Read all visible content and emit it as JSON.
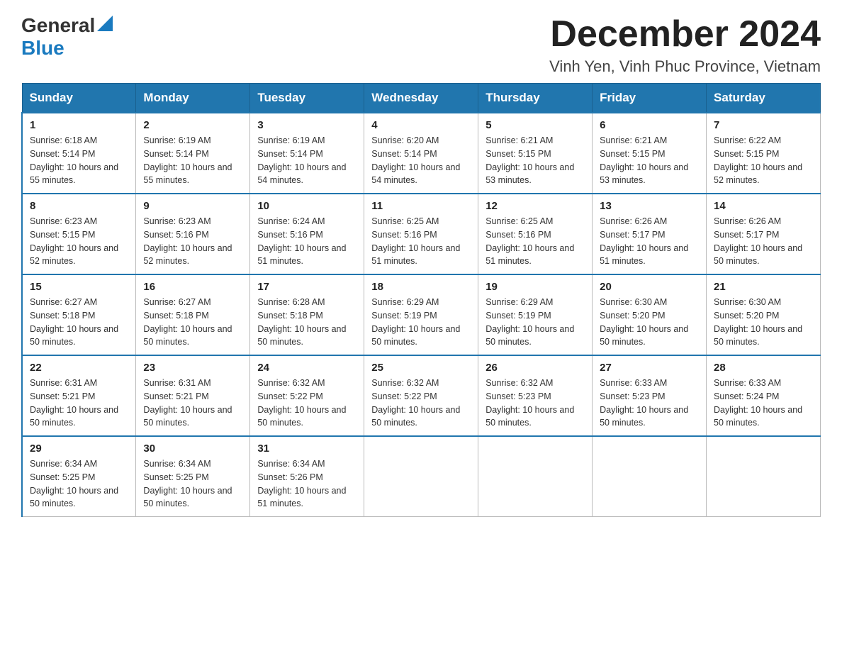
{
  "header": {
    "logo": {
      "general": "General",
      "blue": "Blue"
    },
    "month_title": "December 2024",
    "location": "Vinh Yen, Vinh Phuc Province, Vietnam"
  },
  "days_of_week": [
    "Sunday",
    "Monday",
    "Tuesday",
    "Wednesday",
    "Thursday",
    "Friday",
    "Saturday"
  ],
  "weeks": [
    [
      {
        "day": "1",
        "sunrise": "6:18 AM",
        "sunset": "5:14 PM",
        "daylight": "10 hours and 55 minutes."
      },
      {
        "day": "2",
        "sunrise": "6:19 AM",
        "sunset": "5:14 PM",
        "daylight": "10 hours and 55 minutes."
      },
      {
        "day": "3",
        "sunrise": "6:19 AM",
        "sunset": "5:14 PM",
        "daylight": "10 hours and 54 minutes."
      },
      {
        "day": "4",
        "sunrise": "6:20 AM",
        "sunset": "5:14 PM",
        "daylight": "10 hours and 54 minutes."
      },
      {
        "day": "5",
        "sunrise": "6:21 AM",
        "sunset": "5:15 PM",
        "daylight": "10 hours and 53 minutes."
      },
      {
        "day": "6",
        "sunrise": "6:21 AM",
        "sunset": "5:15 PM",
        "daylight": "10 hours and 53 minutes."
      },
      {
        "day": "7",
        "sunrise": "6:22 AM",
        "sunset": "5:15 PM",
        "daylight": "10 hours and 52 minutes."
      }
    ],
    [
      {
        "day": "8",
        "sunrise": "6:23 AM",
        "sunset": "5:15 PM",
        "daylight": "10 hours and 52 minutes."
      },
      {
        "day": "9",
        "sunrise": "6:23 AM",
        "sunset": "5:16 PM",
        "daylight": "10 hours and 52 minutes."
      },
      {
        "day": "10",
        "sunrise": "6:24 AM",
        "sunset": "5:16 PM",
        "daylight": "10 hours and 51 minutes."
      },
      {
        "day": "11",
        "sunrise": "6:25 AM",
        "sunset": "5:16 PM",
        "daylight": "10 hours and 51 minutes."
      },
      {
        "day": "12",
        "sunrise": "6:25 AM",
        "sunset": "5:16 PM",
        "daylight": "10 hours and 51 minutes."
      },
      {
        "day": "13",
        "sunrise": "6:26 AM",
        "sunset": "5:17 PM",
        "daylight": "10 hours and 51 minutes."
      },
      {
        "day": "14",
        "sunrise": "6:26 AM",
        "sunset": "5:17 PM",
        "daylight": "10 hours and 50 minutes."
      }
    ],
    [
      {
        "day": "15",
        "sunrise": "6:27 AM",
        "sunset": "5:18 PM",
        "daylight": "10 hours and 50 minutes."
      },
      {
        "day": "16",
        "sunrise": "6:27 AM",
        "sunset": "5:18 PM",
        "daylight": "10 hours and 50 minutes."
      },
      {
        "day": "17",
        "sunrise": "6:28 AM",
        "sunset": "5:18 PM",
        "daylight": "10 hours and 50 minutes."
      },
      {
        "day": "18",
        "sunrise": "6:29 AM",
        "sunset": "5:19 PM",
        "daylight": "10 hours and 50 minutes."
      },
      {
        "day": "19",
        "sunrise": "6:29 AM",
        "sunset": "5:19 PM",
        "daylight": "10 hours and 50 minutes."
      },
      {
        "day": "20",
        "sunrise": "6:30 AM",
        "sunset": "5:20 PM",
        "daylight": "10 hours and 50 minutes."
      },
      {
        "day": "21",
        "sunrise": "6:30 AM",
        "sunset": "5:20 PM",
        "daylight": "10 hours and 50 minutes."
      }
    ],
    [
      {
        "day": "22",
        "sunrise": "6:31 AM",
        "sunset": "5:21 PM",
        "daylight": "10 hours and 50 minutes."
      },
      {
        "day": "23",
        "sunrise": "6:31 AM",
        "sunset": "5:21 PM",
        "daylight": "10 hours and 50 minutes."
      },
      {
        "day": "24",
        "sunrise": "6:32 AM",
        "sunset": "5:22 PM",
        "daylight": "10 hours and 50 minutes."
      },
      {
        "day": "25",
        "sunrise": "6:32 AM",
        "sunset": "5:22 PM",
        "daylight": "10 hours and 50 minutes."
      },
      {
        "day": "26",
        "sunrise": "6:32 AM",
        "sunset": "5:23 PM",
        "daylight": "10 hours and 50 minutes."
      },
      {
        "day": "27",
        "sunrise": "6:33 AM",
        "sunset": "5:23 PM",
        "daylight": "10 hours and 50 minutes."
      },
      {
        "day": "28",
        "sunrise": "6:33 AM",
        "sunset": "5:24 PM",
        "daylight": "10 hours and 50 minutes."
      }
    ],
    [
      {
        "day": "29",
        "sunrise": "6:34 AM",
        "sunset": "5:25 PM",
        "daylight": "10 hours and 50 minutes."
      },
      {
        "day": "30",
        "sunrise": "6:34 AM",
        "sunset": "5:25 PM",
        "daylight": "10 hours and 50 minutes."
      },
      {
        "day": "31",
        "sunrise": "6:34 AM",
        "sunset": "5:26 PM",
        "daylight": "10 hours and 51 minutes."
      },
      null,
      null,
      null,
      null
    ]
  ],
  "labels": {
    "sunrise_prefix": "Sunrise: ",
    "sunset_prefix": "Sunset: ",
    "daylight_prefix": "Daylight: "
  }
}
